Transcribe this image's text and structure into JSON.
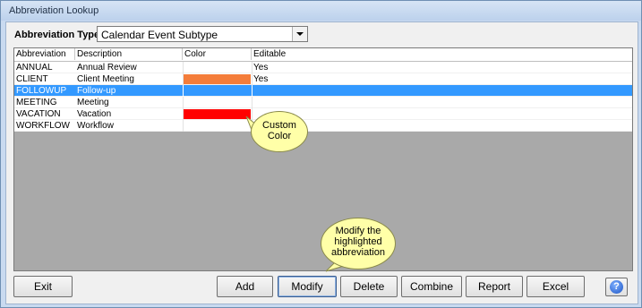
{
  "window": {
    "title": "Abbreviation Lookup"
  },
  "type_field": {
    "label": "Abbreviation Type:",
    "value": "Calendar Event Subtype"
  },
  "grid": {
    "columns": [
      "Abbreviation",
      "Description",
      "Color",
      "Editable"
    ],
    "rows": [
      {
        "abbr": "ANNUAL",
        "desc": "Annual Review",
        "color": "",
        "editable": "Yes"
      },
      {
        "abbr": "CLIENT",
        "desc": "Client Meeting",
        "color": "#f47d3a",
        "editable": "Yes"
      },
      {
        "abbr": "FOLLOWUP",
        "desc": "Follow-up",
        "color": "",
        "editable": ""
      },
      {
        "abbr": "MEETING",
        "desc": "Meeting",
        "color": "",
        "editable": ""
      },
      {
        "abbr": "VACATION",
        "desc": "Vacation",
        "color": "#ff0000",
        "editable": ""
      },
      {
        "abbr": "WORKFLOW",
        "desc": "Workflow",
        "color": "",
        "editable": ""
      }
    ],
    "selected_row": "FOLLOWUP"
  },
  "callouts": {
    "custom_color": {
      "line1": "Custom",
      "line2": "Color"
    },
    "modify": {
      "line1": "Modify the",
      "line2": "highlighted",
      "line3": "abbreviation"
    }
  },
  "buttons": {
    "exit": "Exit",
    "add": "Add",
    "modify": "Modify",
    "delete": "Delete",
    "combine": "Combine",
    "report": "Report",
    "excel": "Excel",
    "help_icon": "?"
  },
  "colors": {
    "selection": "#3399ff",
    "callout_fill": "#ffffa8",
    "grid_background": "#a9a9a9"
  }
}
